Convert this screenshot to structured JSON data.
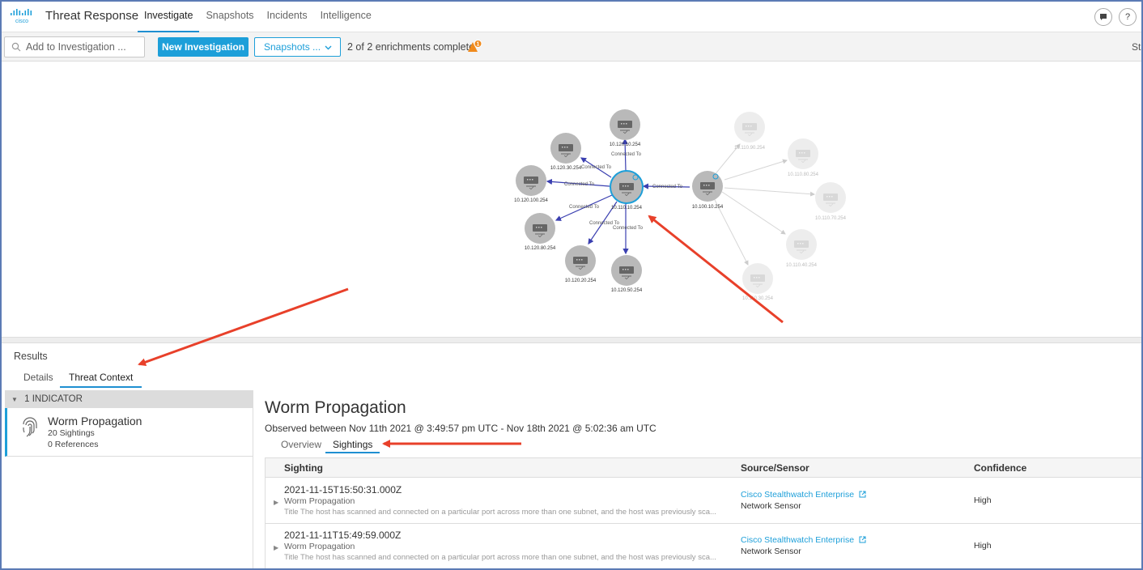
{
  "app": {
    "logo_text": "cisco",
    "title": "Threat Response"
  },
  "nav": [
    {
      "label": "Investigate",
      "active": true
    },
    {
      "label": "Snapshots",
      "active": false
    },
    {
      "label": "Incidents",
      "active": false
    },
    {
      "label": "Intelligence",
      "active": false
    }
  ],
  "header_icons": {
    "chat": "chat-bubble-icon",
    "help_label": "?"
  },
  "toolbar": {
    "search_placeholder": "Add to Investigation ...",
    "new_investigation": "New Investigation",
    "snapshots": "Snapshots ...",
    "enrichment_status": "2 of 2 enrichments complete",
    "warning_count": "1",
    "right_truncated": "Sta"
  },
  "graph": {
    "edge_label": "Connected To",
    "center": "10.110.10.254",
    "hub": "10.100.10.254",
    "neighbors": [
      "10.120.10.254",
      "10.120.30.254",
      "10.120.100.254",
      "10.120.80.254",
      "10.120.20.254",
      "10.120.50.254"
    ],
    "faded": [
      "10.110.90.254",
      "10.110.80.254",
      "10.110.70.254",
      "10.110.40.254",
      "10.110.30.254"
    ]
  },
  "results": {
    "label": "Results",
    "tabs": [
      {
        "label": "Details",
        "active": false
      },
      {
        "label": "Threat Context",
        "active": true
      }
    ],
    "indicator_header": "1 INDICATOR",
    "indicator": {
      "title": "Worm Propagation",
      "sightings": "20 Sightings",
      "references": "0 References",
      "icon": "fingerprint-icon"
    }
  },
  "detail": {
    "title": "Worm Propagation",
    "observed": "Observed between Nov 11th 2021 @ 3:49:57 pm UTC - Nov 18th 2021 @ 5:02:36 am UTC",
    "tabs": [
      {
        "label": "Overview",
        "active": false
      },
      {
        "label": "Sightings",
        "active": true
      }
    ],
    "columns": [
      "Sighting",
      "Source/Sensor",
      "Confidence"
    ],
    "rows": [
      {
        "timestamp": "2021-11-15T15:50:31.000Z",
        "name": "Worm Propagation",
        "description": "Title The host has scanned and connected on a particular port across more than one subnet, and the host was previously sca...",
        "source": "Cisco Stealthwatch Enterprise",
        "sensor": "Network Sensor",
        "confidence": "High"
      },
      {
        "timestamp": "2021-11-11T15:49:59.000Z",
        "name": "Worm Propagation",
        "description": "Title The host has scanned and connected on a particular port across more than one subnet, and the host was previously sca...",
        "source": "Cisco Stealthwatch Enterprise",
        "sensor": "Network Sensor",
        "confidence": "High"
      }
    ]
  },
  "colors": {
    "accent": "#1d9fd9",
    "annotation_arrow": "#e8402a",
    "edge": "#3a3fb0",
    "node": "#b9b9b9"
  }
}
